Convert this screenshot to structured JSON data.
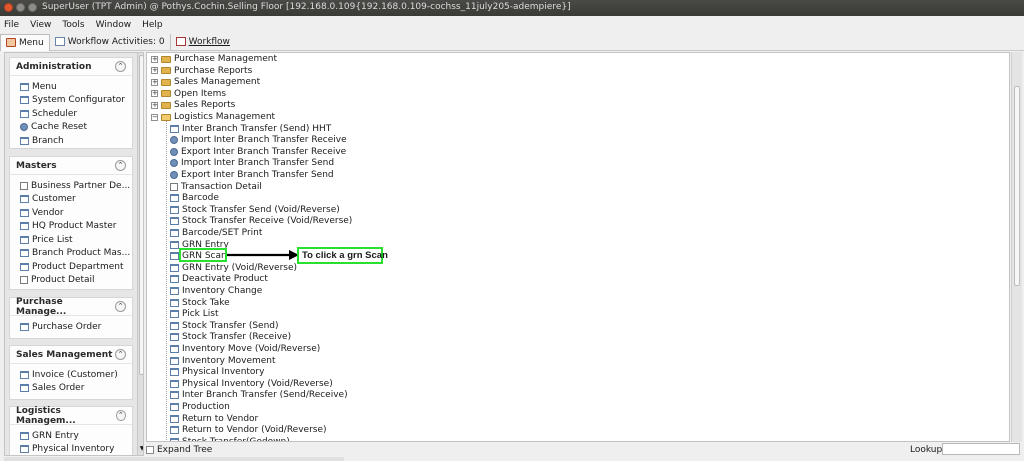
{
  "window": {
    "title": "SuperUser (TPT Admin) @ Pothys.Cochin.Selling Floor [192.168.0.109{192.168.0.109-cochss_11july205-adempiere}]"
  },
  "menubar": {
    "items": [
      "File",
      "View",
      "Tools",
      "Window",
      "Help"
    ]
  },
  "tabs": {
    "menu": "Menu",
    "workflow_activities": "Workflow Activities: 0",
    "workflow": "Workflow"
  },
  "sidebar": {
    "sections": [
      {
        "title": "Administration",
        "items": [
          {
            "label": "Menu",
            "icon": "window-icon"
          },
          {
            "label": "System Configurator",
            "icon": "window-icon"
          },
          {
            "label": "Scheduler",
            "icon": "window-icon"
          },
          {
            "label": "Cache Reset",
            "icon": "process-icon"
          },
          {
            "label": "Branch",
            "icon": "window-icon"
          }
        ]
      },
      {
        "title": "Masters",
        "items": [
          {
            "label": "Business Partner De...",
            "icon": "form-icon"
          },
          {
            "label": "Customer",
            "icon": "window-icon"
          },
          {
            "label": "Vendor",
            "icon": "window-icon"
          },
          {
            "label": "HQ Product Master",
            "icon": "window-icon"
          },
          {
            "label": "Price List",
            "icon": "window-icon"
          },
          {
            "label": "Branch Product Mas...",
            "icon": "window-icon"
          },
          {
            "label": "Product Department",
            "icon": "window-icon"
          },
          {
            "label": "Product Detail",
            "icon": "form-icon"
          }
        ]
      },
      {
        "title": "Purchase Manage...",
        "items": [
          {
            "label": "Purchase Order",
            "icon": "window-icon"
          }
        ]
      },
      {
        "title": "Sales Management",
        "items": [
          {
            "label": "Invoice (Customer)",
            "icon": "window-icon"
          },
          {
            "label": "Sales Order",
            "icon": "window-icon"
          }
        ]
      },
      {
        "title": "Logistics Managem...",
        "items": [
          {
            "label": "GRN Entry",
            "icon": "window-icon"
          },
          {
            "label": "Physical Inventory",
            "icon": "window-icon"
          }
        ]
      }
    ]
  },
  "tree": {
    "folders": [
      {
        "label": "Purchase Management",
        "expanded": false
      },
      {
        "label": "Purchase Reports",
        "expanded": false
      },
      {
        "label": "Sales Management",
        "expanded": false
      },
      {
        "label": "Open Items",
        "expanded": false
      },
      {
        "label": "Sales Reports",
        "expanded": false
      },
      {
        "label": "Logistics Management",
        "expanded": true
      }
    ],
    "children": [
      {
        "label": "Inter Branch Transfer (Send) HHT",
        "icon": "window-icon"
      },
      {
        "label": "Import Inter Branch Transfer Receive",
        "icon": "process-icon"
      },
      {
        "label": "Export Inter Branch Transfer Receive",
        "icon": "process-icon"
      },
      {
        "label": "Import Inter Branch Transfer Send",
        "icon": "process-icon"
      },
      {
        "label": "Export Inter Branch Transfer Send",
        "icon": "process-icon"
      },
      {
        "label": "Transaction Detail",
        "icon": "form-icon"
      },
      {
        "label": "Barcode",
        "icon": "window-icon"
      },
      {
        "label": "Stock Transfer Send (Void/Reverse)",
        "icon": "window-icon"
      },
      {
        "label": "Stock Transfer Receive (Void/Reverse)",
        "icon": "window-icon"
      },
      {
        "label": "Barcode/SET Print",
        "icon": "window-icon"
      },
      {
        "label": "GRN Entry",
        "icon": "window-icon"
      },
      {
        "label": "GRN Scan",
        "icon": "window-icon"
      },
      {
        "label": "GRN Entry (Void/Reverse)",
        "icon": "window-icon"
      },
      {
        "label": "Deactivate Product",
        "icon": "window-icon"
      },
      {
        "label": "Inventory Change",
        "icon": "window-icon"
      },
      {
        "label": "Stock Take",
        "icon": "window-icon"
      },
      {
        "label": "Pick List",
        "icon": "window-icon"
      },
      {
        "label": "Stock Transfer (Send)",
        "icon": "window-icon"
      },
      {
        "label": "Stock Transfer (Receive)",
        "icon": "window-icon"
      },
      {
        "label": "Inventory Move (Void/Reverse)",
        "icon": "window-icon"
      },
      {
        "label": "Inventory Movement",
        "icon": "window-icon"
      },
      {
        "label": "Physical Inventory",
        "icon": "window-icon"
      },
      {
        "label": "Physical Inventory (Void/Reverse)",
        "icon": "window-icon"
      },
      {
        "label": "Inter Branch Transfer (Send/Receive)",
        "icon": "window-icon"
      },
      {
        "label": "Production",
        "icon": "window-icon"
      },
      {
        "label": "Return to Vendor",
        "icon": "window-icon"
      },
      {
        "label": "Return to Vendor (Void/Reverse)",
        "icon": "window-icon"
      },
      {
        "label": "Stock Transfer(Godown)",
        "icon": "window-icon"
      }
    ]
  },
  "annotation": {
    "text": "To click a grn Scan",
    "color": "#27e030"
  },
  "bottom": {
    "expand_tree": "Expand Tree",
    "lookup": "Lookup",
    "lookup_value": ""
  }
}
